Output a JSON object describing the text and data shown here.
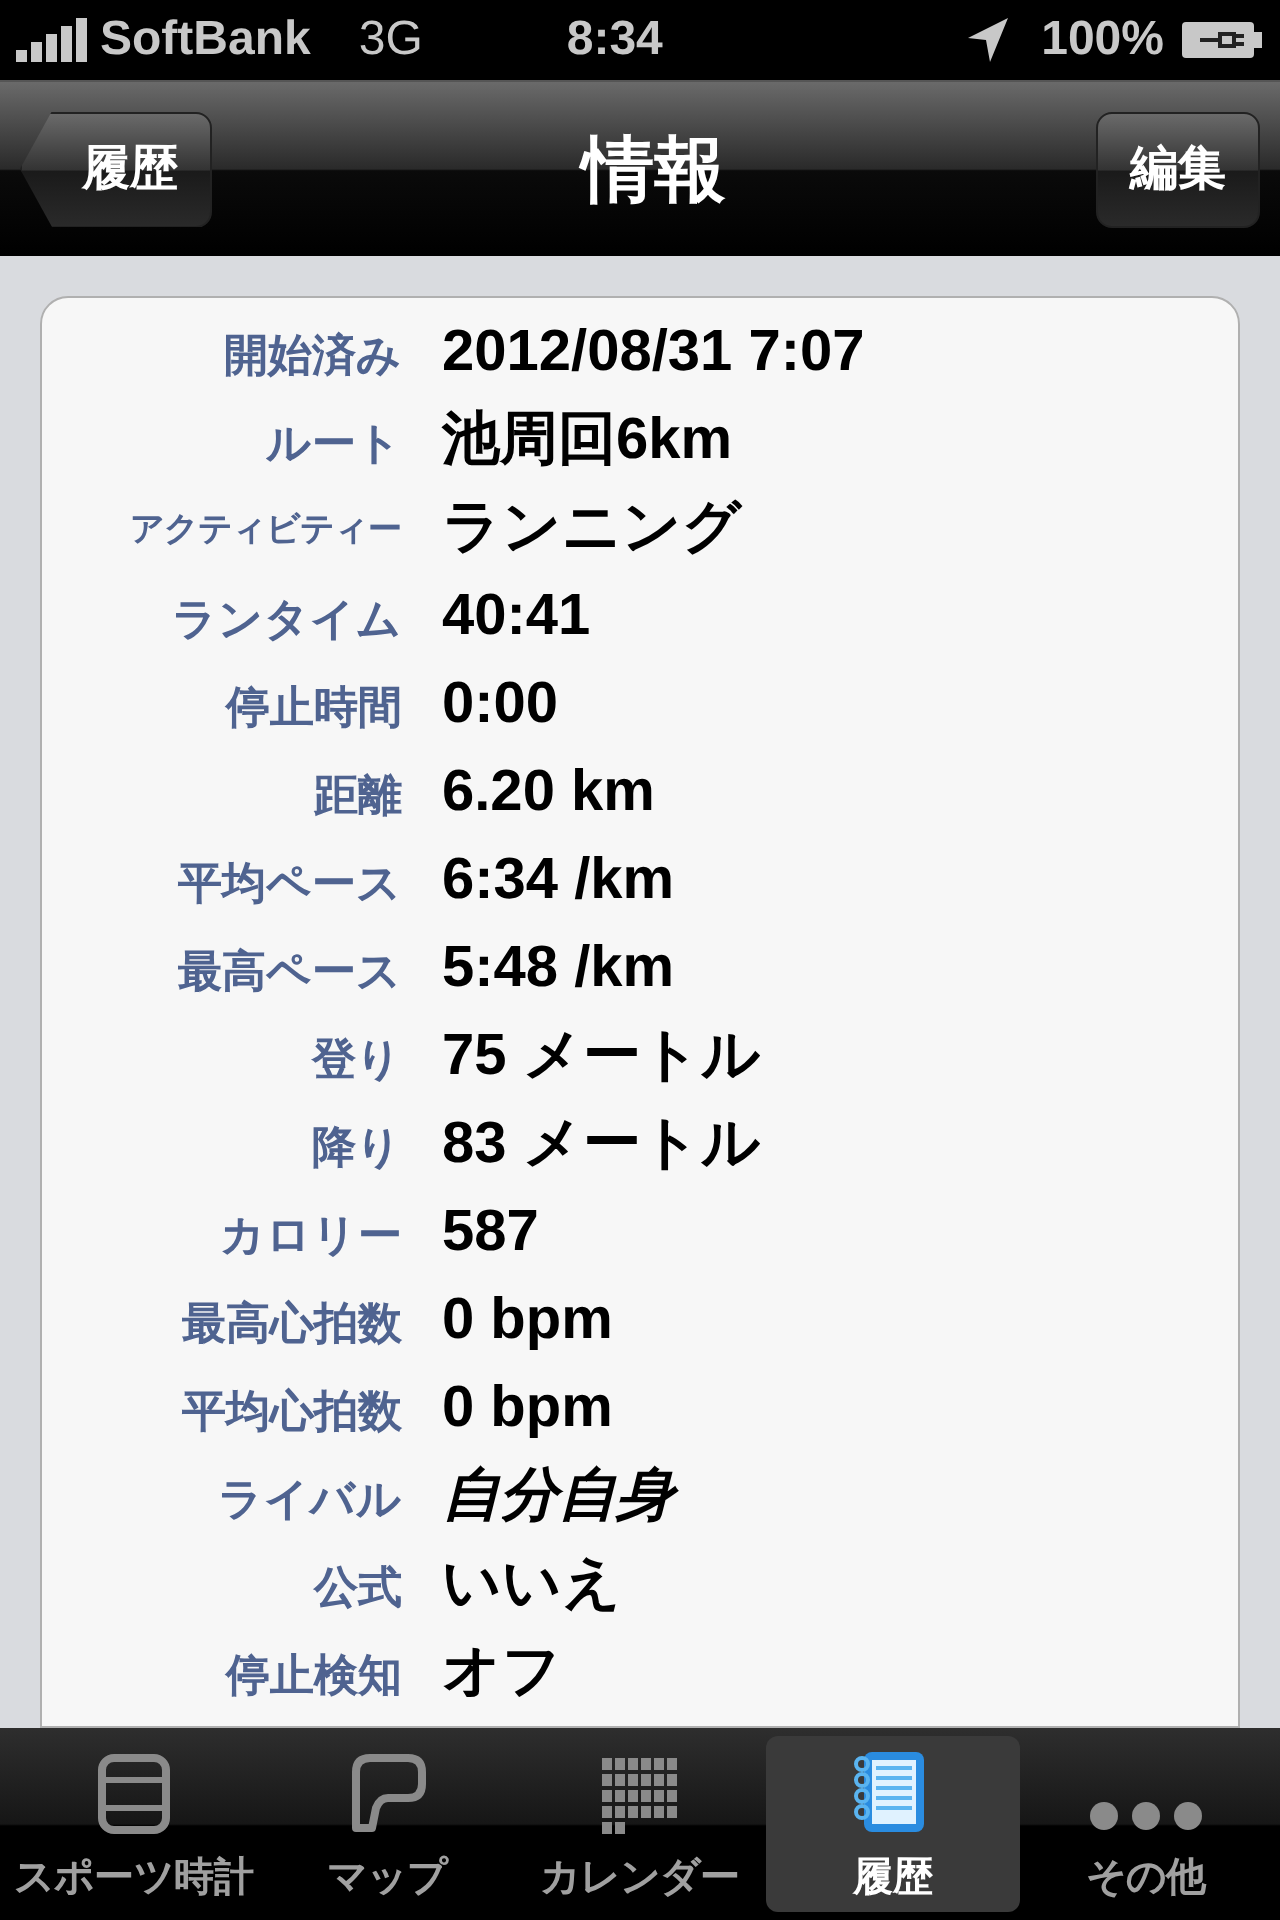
{
  "status_bar": {
    "carrier": "SoftBank",
    "network": "3G",
    "time": "8:34",
    "battery": "100%"
  },
  "nav_bar": {
    "back": "履歴",
    "title": "情報",
    "edit": "編集"
  },
  "details": [
    {
      "label": "開始済み",
      "value": "2012/08/31 7:07",
      "small": false,
      "italic": false
    },
    {
      "label": "ルート",
      "value": "池周回6km",
      "small": false,
      "italic": false
    },
    {
      "label": "アクティビティー",
      "value": "ランニング",
      "small": true,
      "italic": false
    },
    {
      "label": "ランタイム",
      "value": "40:41",
      "small": false,
      "italic": false
    },
    {
      "label": "停止時間",
      "value": "0:00",
      "small": false,
      "italic": false
    },
    {
      "label": "距離",
      "value": "6.20 km",
      "small": false,
      "italic": false
    },
    {
      "label": "平均ペース",
      "value": "6:34 /km",
      "small": false,
      "italic": false
    },
    {
      "label": "最高ペース",
      "value": "5:48 /km",
      "small": false,
      "italic": false
    },
    {
      "label": "登り",
      "value": "75 メートル",
      "small": false,
      "italic": false
    },
    {
      "label": "降り",
      "value": "83 メートル",
      "small": false,
      "italic": false
    },
    {
      "label": "カロリー",
      "value": "587",
      "small": false,
      "italic": false
    },
    {
      "label": "最高心拍数",
      "value": "0 bpm",
      "small": false,
      "italic": false
    },
    {
      "label": "平均心拍数",
      "value": "0 bpm",
      "small": false,
      "italic": false
    },
    {
      "label": "ライバル",
      "value": "自分自身",
      "small": false,
      "italic": true
    },
    {
      "label": "公式",
      "value": "いいえ",
      "small": false,
      "italic": false
    },
    {
      "label": "停止検知",
      "value": "オフ",
      "small": false,
      "italic": false
    }
  ],
  "tabs": [
    {
      "label": "スポーツ時計",
      "kind": "watch",
      "selected": false
    },
    {
      "label": "マップ",
      "kind": "map",
      "selected": false
    },
    {
      "label": "カレンダー",
      "kind": "calendar",
      "selected": false
    },
    {
      "label": "履歴",
      "kind": "history",
      "selected": true
    },
    {
      "label": "その他",
      "kind": "more",
      "selected": false
    }
  ]
}
